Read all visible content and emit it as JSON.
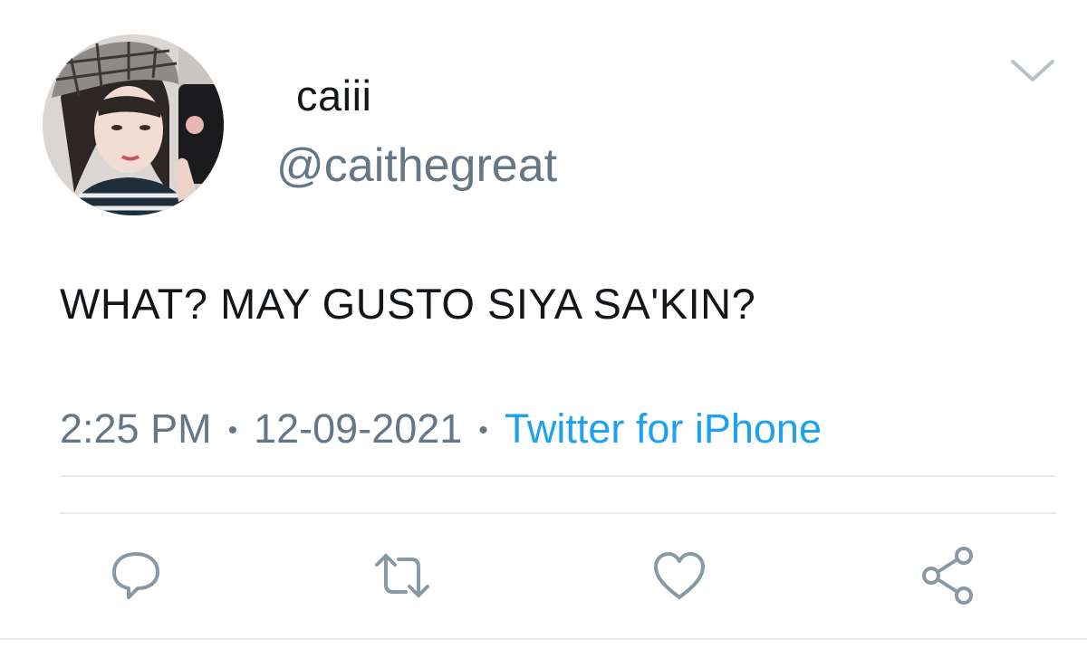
{
  "user": {
    "display_name": "caiii",
    "handle": "@caithegreat",
    "avatar_icon": "profile-photo"
  },
  "tweet": {
    "text": "WHAT? MAY GUSTO SIYA SA'KIN?",
    "time": "2:25 PM",
    "separator": "•",
    "date": "12-09-2021",
    "source": "Twitter for iPhone"
  },
  "actions": [
    {
      "icon": "reply-icon"
    },
    {
      "icon": "retweet-icon"
    },
    {
      "icon": "like-icon"
    },
    {
      "icon": "share-icon"
    }
  ],
  "colors": {
    "text": "#14171a",
    "secondary": "#657786",
    "link": "#1da1f2",
    "divider": "#e6ecf0",
    "icon": "#8899a6"
  }
}
